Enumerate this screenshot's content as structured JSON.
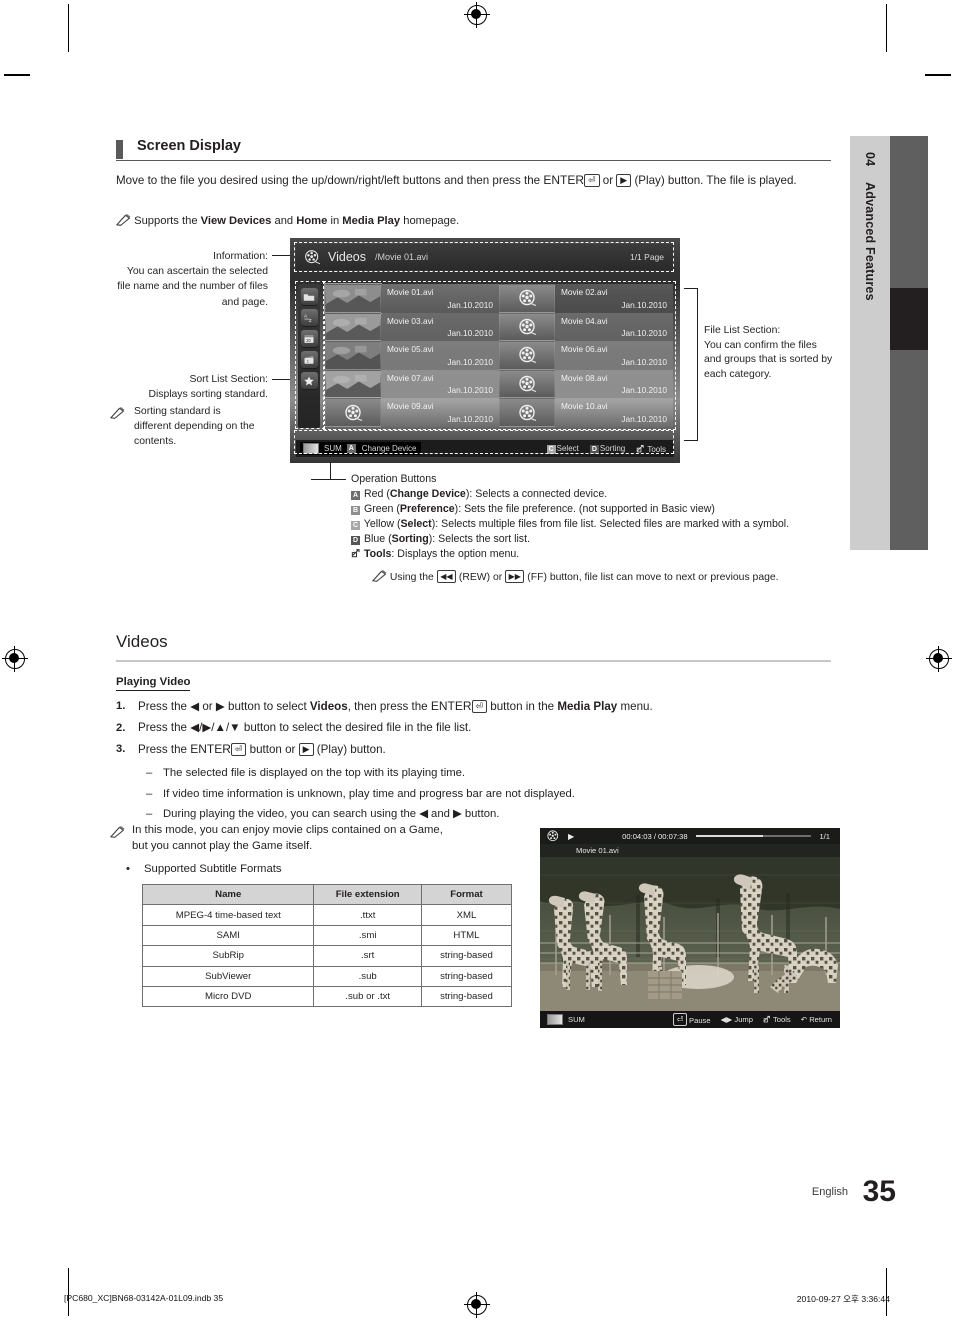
{
  "sidebar_tab": {
    "number": "04",
    "label": "Advanced Features"
  },
  "section": {
    "heading": "Screen Display",
    "intro_1": "Move to the file you desired using the up/down/right/left buttons and then press the ",
    "intro_enter": "ENTER",
    "intro_2": " or ",
    "intro_3": " (Play) button. The file is played.",
    "note_supports_1": "Supports the ",
    "note_supports_b1": "View Devices",
    "note_supports_2": " and ",
    "note_supports_b2": "Home",
    "note_supports_3": " in ",
    "note_supports_b3": "Media Play",
    "note_supports_4": " homepage."
  },
  "callouts": {
    "information": {
      "line1": "Information:",
      "line2": "You can ascertain the selected",
      "line3": "file name and the number of files",
      "line4": "and page."
    },
    "sort_list": {
      "line1": "Sort List Section:",
      "line2": "Displays sorting standard."
    },
    "sort_note": {
      "line1": "Sorting standard is",
      "line2": "different depending on the",
      "line3": "contents."
    },
    "file_list": {
      "line1": "File List Section:",
      "line2": "You can confirm the files",
      "line3": "and groups that is sorted by",
      "line4": "each category."
    }
  },
  "tv_screen": {
    "title": "Videos",
    "path": "/Movie 01.avi",
    "page": "1/1 Page",
    "sort_icons": [
      "folder-icon",
      "a-z-icon",
      "calendar-30-icon",
      "clapperboard-icon",
      "star-icon"
    ],
    "files": [
      {
        "name": "Movie 01.avi",
        "date": "Jan.10.2010",
        "thumb": "photo",
        "selected": true
      },
      {
        "name": "Movie 02.avi",
        "date": "Jan.10.2010",
        "thumb": "reel",
        "selected": false
      },
      {
        "name": "Movie 03.avi",
        "date": "Jan.10.2010",
        "thumb": "photo",
        "selected": false
      },
      {
        "name": "Movie 04.avi",
        "date": "Jan.10.2010",
        "thumb": "reel",
        "selected": false
      },
      {
        "name": "Movie 05.avi",
        "date": "Jan.10.2010",
        "thumb": "photo",
        "selected": false
      },
      {
        "name": "Movie 06.avi",
        "date": "Jan.10.2010",
        "thumb": "reel",
        "selected": false
      },
      {
        "name": "Movie 07.avi",
        "date": "Jan.10.2010",
        "thumb": "photo",
        "selected": false
      },
      {
        "name": "Movie 08.avi",
        "date": "Jan.10.2010",
        "thumb": "reel",
        "selected": false
      },
      {
        "name": "Movie 09.avi",
        "date": "Jan.10.2010",
        "thumb": "reel",
        "selected": false
      },
      {
        "name": "Movie 10.avi",
        "date": "Jan.10.2010",
        "thumb": "reel",
        "selected": false
      }
    ],
    "footer_left": {
      "sum": "SUM",
      "key_a": "A",
      "change_device": "Change Device"
    },
    "footer_right": {
      "key_c": "C",
      "select": "Select",
      "key_d": "D",
      "sorting": "Sorting",
      "tools": "Tools"
    }
  },
  "operation_buttons": {
    "title": "Operation Buttons",
    "items": [
      {
        "key": "A",
        "color": "Red",
        "action": "Change Device",
        "desc": "Selects a connected device."
      },
      {
        "key": "B",
        "color": "Green",
        "action": "Preference",
        "desc": "Sets the file preference. (not supported in Basic view)"
      },
      {
        "key": "C",
        "color": "Yellow",
        "action": "Select",
        "desc": "Selects multiple files from file list. Selected files are marked with a symbol."
      },
      {
        "key": "D",
        "color": "Blue",
        "action": "Sorting",
        "desc": "Selects the sort list."
      }
    ],
    "tools_label": "Tools",
    "tools_desc": ": Displays the option menu.",
    "note_1": "Using the ",
    "note_rew": "REW",
    "note_2": ") or ",
    "note_ff": "FF",
    "note_3": ") button, file list can move to next or previous page."
  },
  "videos": {
    "heading": "Videos",
    "subheading": "Playing Video",
    "steps": [
      {
        "num": "1.",
        "parts": [
          "Press the ",
          "◀",
          " or ",
          "▶",
          " button to select ",
          "Videos",
          ", then press the ",
          "ENTER",
          " button in the ",
          "Media Play",
          " menu."
        ]
      },
      {
        "num": "2.",
        "text_a": "Press the ",
        "arrows": "◀/▶/▲/▼",
        "text_b": " button to select the desired file in the file list."
      },
      {
        "num": "3.",
        "text_a": "Press the ",
        "enter": "ENTER",
        "text_b": " button or ",
        "text_c": " (Play) button."
      }
    ],
    "bullets": [
      "The selected file is displayed on the top with its playing time.",
      "If video time information is unknown, play time and progress bar are not displayed.",
      "During playing the video, you can search using the ◀ and ▶ button."
    ],
    "game_note_1": "In this mode, you can enjoy movie clips contained on a Game,",
    "game_note_2": "but you cannot play the Game itself.",
    "subtitle_bullet": "Supported Subtitle Formats"
  },
  "subtitle_table": {
    "headers": [
      "Name",
      "File extension",
      "Format"
    ],
    "rows": [
      [
        "MPEG-4 time-based text",
        ".ttxt",
        "XML"
      ],
      [
        "SAMI",
        ".smi",
        "HTML"
      ],
      [
        "SubRip",
        ".srt",
        "string-based"
      ],
      [
        "SubViewer",
        ".sub",
        "string-based"
      ],
      [
        "Micro DVD",
        ".sub or .txt",
        "string-based"
      ]
    ]
  },
  "player": {
    "filename": "Movie 01.avi",
    "time": "00:04:03 / 00:07:38",
    "page": "1/1",
    "progress_percent": 58,
    "sum": "SUM",
    "buttons": [
      "Pause",
      "Jump",
      "Tools",
      "Return"
    ]
  },
  "footer": {
    "language": "English",
    "page_number": "35",
    "slug_left": "[PC680_XC]BN68-03142A-01L09.indb   35",
    "slug_right": "2010-09-27   오후 3:36:44"
  }
}
